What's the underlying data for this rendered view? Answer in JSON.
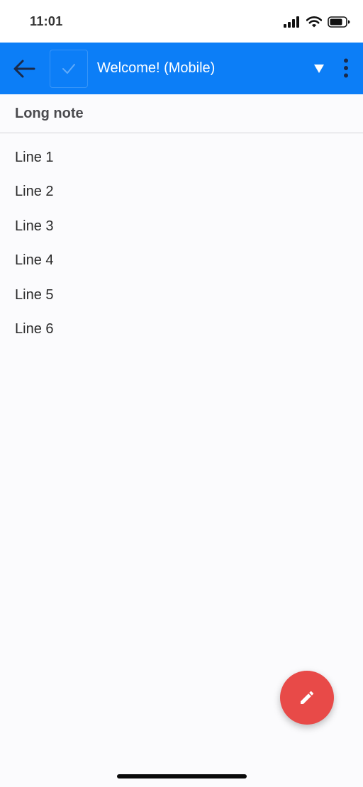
{
  "status_bar": {
    "time": "11:01",
    "icons": [
      "cellular-signal-icon",
      "wifi-icon",
      "battery-icon"
    ]
  },
  "app_bar": {
    "title": "Welcome! (Mobile)",
    "background_color": "#0c7ef7",
    "icons": [
      "arrow-left-icon",
      "check-icon",
      "triangle-down-icon",
      "more-vertical-icon"
    ]
  },
  "note": {
    "title": "Long note",
    "lines": [
      "Line 1",
      "Line 2",
      "Line 3",
      "Line 4",
      "Line 5",
      "Line 6"
    ]
  },
  "fab": {
    "icon": "pencil-icon",
    "color": "#e84a48"
  }
}
